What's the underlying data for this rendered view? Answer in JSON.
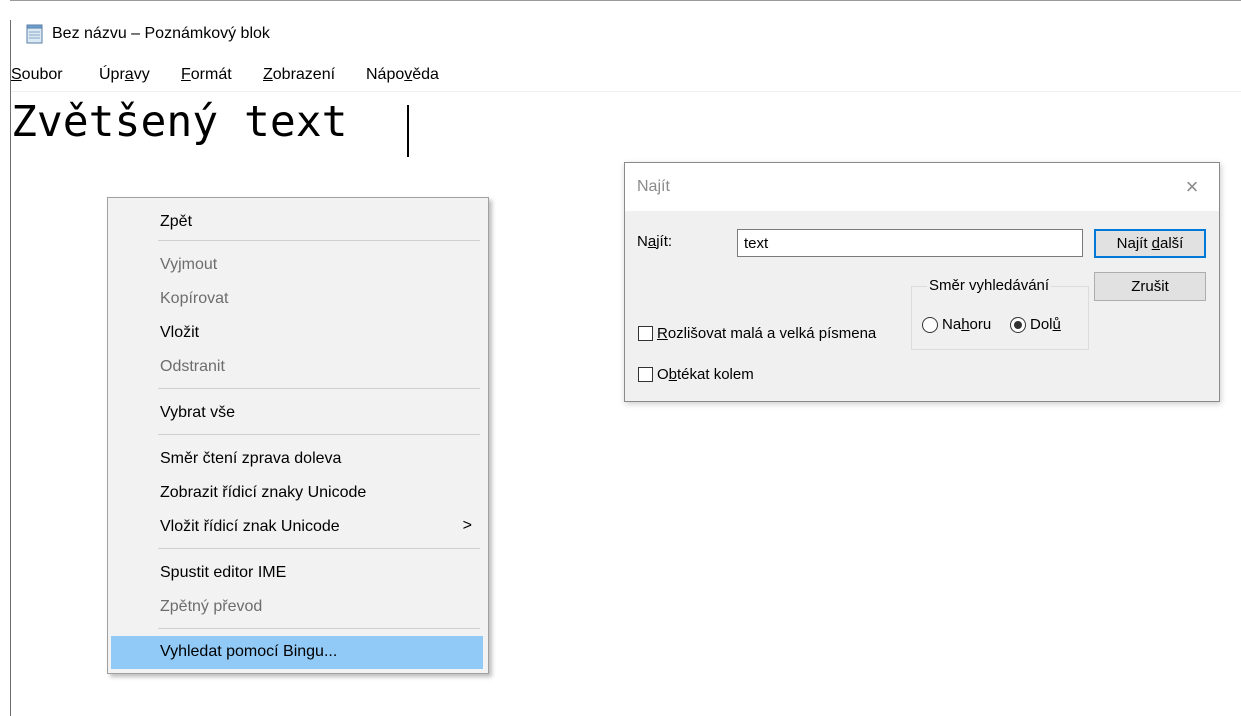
{
  "window": {
    "title": "Bez názvu – Poznámkový blok"
  },
  "menubar": {
    "items": [
      {
        "pre": "",
        "acc": "S",
        "post": "oubor"
      },
      {
        "pre": "Úpr",
        "acc": "a",
        "post": "vy"
      },
      {
        "pre": "",
        "acc": "F",
        "post": "ormát"
      },
      {
        "pre": "",
        "acc": "Z",
        "post": "obrazení"
      },
      {
        "pre": "Nápo",
        "acc": "v",
        "post": "ěda"
      }
    ]
  },
  "editor": {
    "content": "Zvětšený text"
  },
  "context_menu": {
    "items": [
      {
        "label": "Zpět",
        "enabled": true
      },
      {
        "label": "Vyjmout",
        "enabled": false
      },
      {
        "label": "Kopírovat",
        "enabled": false
      },
      {
        "label": "Vložit",
        "enabled": true
      },
      {
        "label": "Odstranit",
        "enabled": false
      },
      {
        "label": "Vybrat vše",
        "enabled": true
      },
      {
        "label": "Směr čtení zprava doleva",
        "enabled": true
      },
      {
        "label": "Zobrazit řídicí znaky Unicode",
        "enabled": true
      },
      {
        "label": "Vložit řídicí znak Unicode",
        "enabled": true,
        "submenu_arrow": ">"
      },
      {
        "label": "Spustit editor IME",
        "enabled": true
      },
      {
        "label": "Zpětný převod",
        "enabled": false
      },
      {
        "label": "Vyhledat pomocí Bingu...",
        "enabled": true,
        "highlighted": true
      }
    ]
  },
  "find_dialog": {
    "title": "Najít",
    "close_icon": "×",
    "find_label_pre": "N",
    "find_label_acc": "a",
    "find_label_post": "jít:",
    "find_value": "text",
    "find_next_pre": "Najít ",
    "find_next_acc": "d",
    "find_next_post": "alší",
    "cancel_label": "Zrušit",
    "direction_legend": "Směr vyhledávání",
    "up_pre": "Na",
    "up_acc": "h",
    "up_post": "oru",
    "down_pre": "Dol",
    "down_acc": "ů",
    "down_post": "",
    "direction_selected": "down",
    "match_case_acc": "R",
    "match_case_post": "ozlišovat malá a velká písmena",
    "match_case_checked": false,
    "wrap_pre": "O",
    "wrap_acc": "b",
    "wrap_post": "tékat kolem",
    "wrap_checked": false
  },
  "colors": {
    "menu_highlight": "#91c9f7",
    "disabled_text": "#6d6d6d",
    "dialog_bg": "#f0f0f0"
  }
}
